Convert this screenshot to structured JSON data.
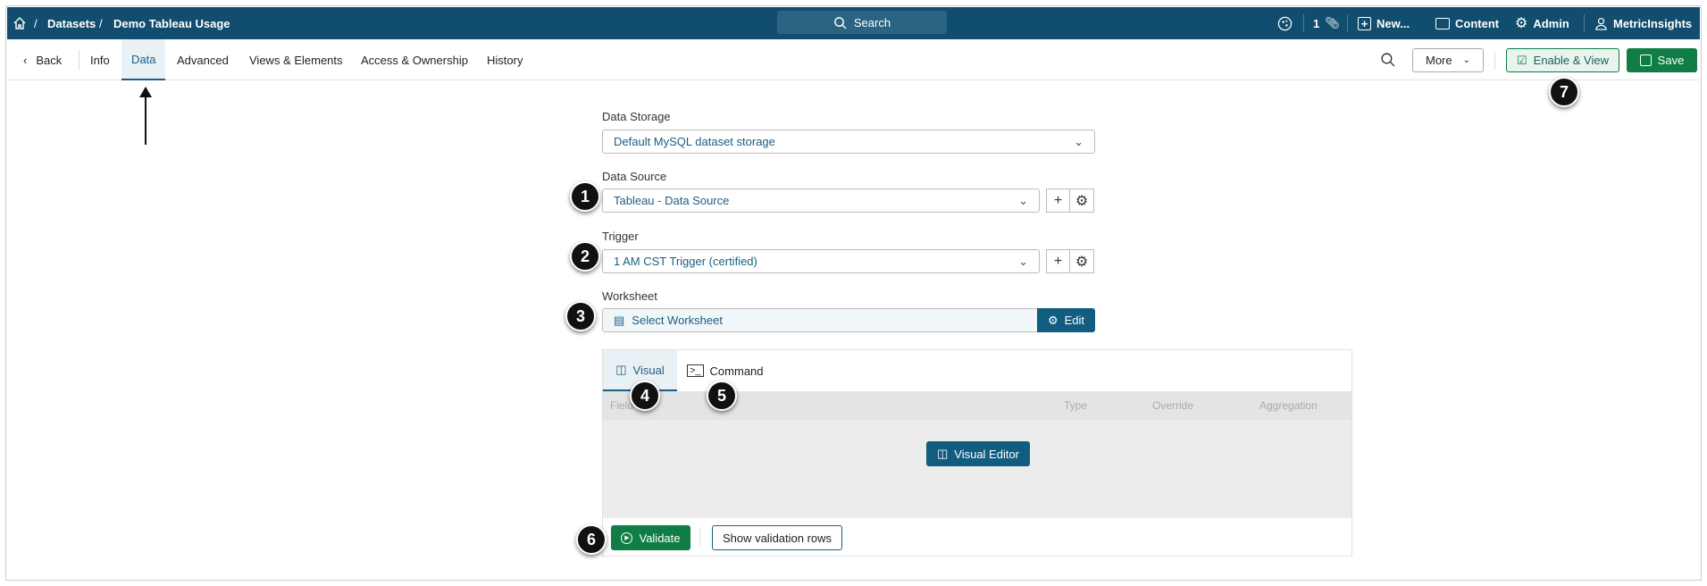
{
  "topbar": {
    "breadcrumb": [
      "Datasets",
      "Demo Tableau Usage"
    ],
    "search": "Search",
    "count": "1",
    "new": "New...",
    "content": "Content",
    "admin": "Admin",
    "user": "MetricInsights"
  },
  "nav": {
    "back": "Back",
    "tabs": [
      "Info",
      "Data",
      "Advanced",
      "Views & Elements",
      "Access & Ownership",
      "History"
    ],
    "active": "Data",
    "more": "More",
    "enable_view": "Enable & View",
    "save": "Save"
  },
  "form": {
    "data_storage": {
      "label": "Data Storage",
      "value": "Default MySQL dataset storage"
    },
    "data_source": {
      "label": "Data Source",
      "value": "Tableau - Data Source"
    },
    "trigger": {
      "label": "Trigger",
      "value": "1 AM CST Trigger (certified)"
    },
    "worksheet": {
      "label": "Worksheet",
      "value": "Select Worksheet",
      "edit": "Edit"
    }
  },
  "panel": {
    "tabs": [
      "Visual",
      "Command"
    ],
    "columns": [
      "Field",
      "Type",
      "Override",
      "Aggregation"
    ],
    "visual_editor": "Visual Editor",
    "validate": "Validate",
    "show_rows": "Show validation rows"
  },
  "markers": [
    "1",
    "2",
    "3",
    "4",
    "5",
    "6",
    "7"
  ],
  "colors": {
    "brand": "#114d6e",
    "accent": "#1b5e83",
    "green": "#0f7d45"
  }
}
